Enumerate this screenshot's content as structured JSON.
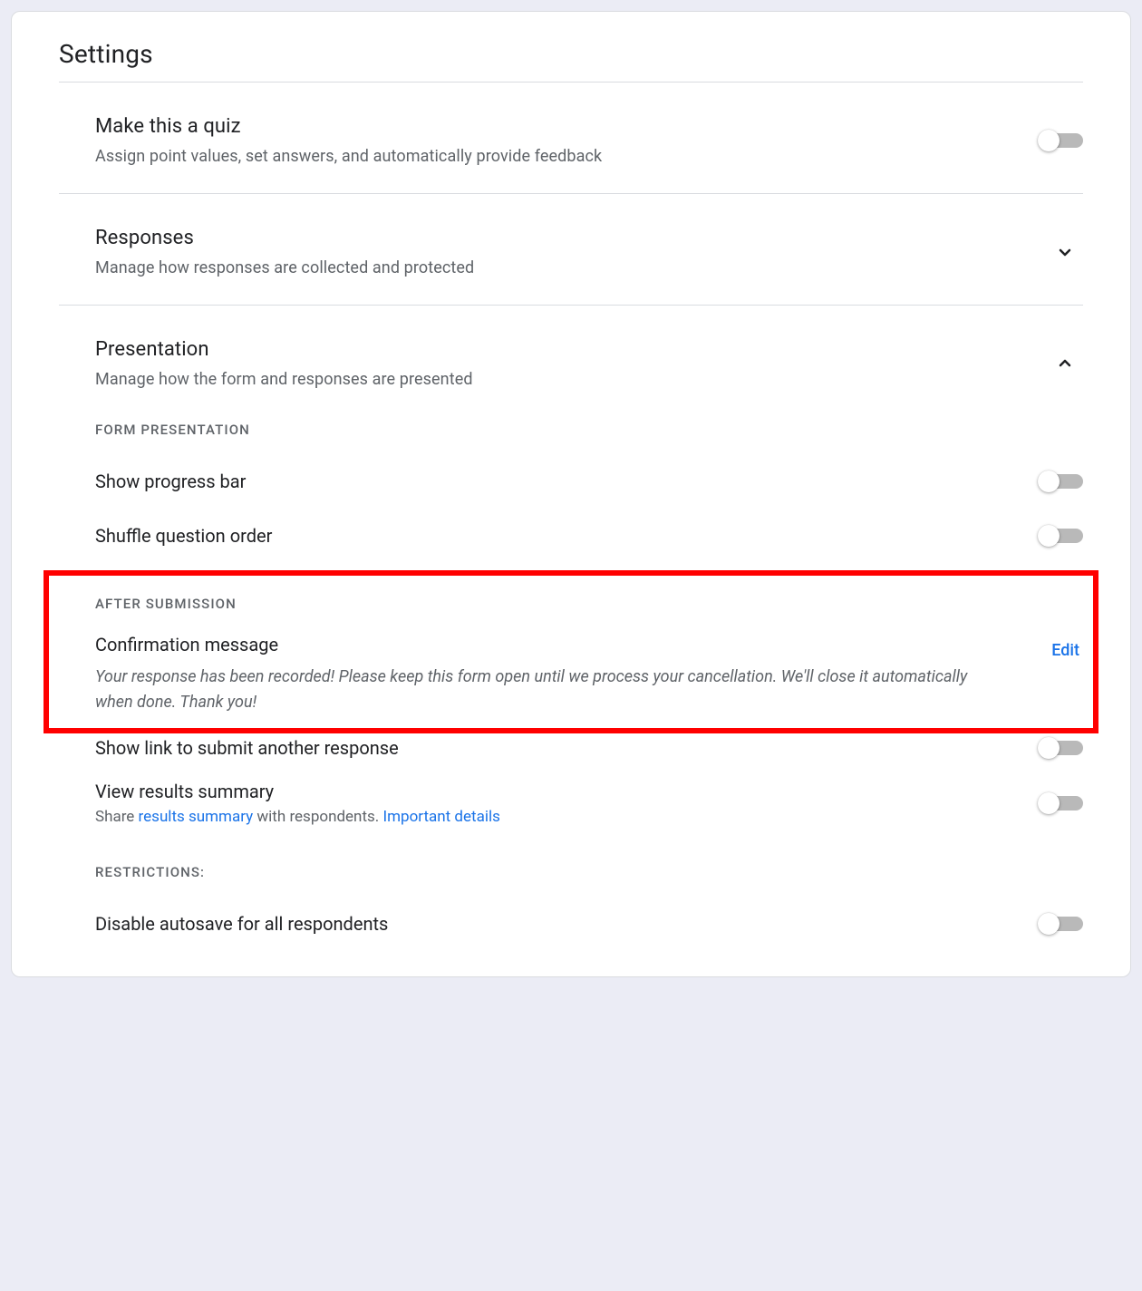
{
  "page_title": "Settings",
  "quiz": {
    "title": "Make this a quiz",
    "subtitle": "Assign point values, set answers, and automatically provide feedback",
    "enabled": false
  },
  "responses": {
    "title": "Responses",
    "subtitle": "Manage how responses are collected and protected",
    "expanded": false
  },
  "presentation": {
    "title": "Presentation",
    "subtitle": "Manage how the form and responses are presented",
    "expanded": true,
    "form_presentation_label": "FORM PRESENTATION",
    "show_progress_bar": {
      "label": "Show progress bar",
      "enabled": false
    },
    "shuffle_questions": {
      "label": "Shuffle question order",
      "enabled": false
    },
    "after_submission_label": "AFTER SUBMISSION",
    "confirmation": {
      "title": "Confirmation message",
      "message": "Your response has been recorded! Please keep this form open until we process your cancellation. We'll close it automatically when done. Thank you!",
      "edit_label": "Edit"
    },
    "show_submit_another": {
      "label": "Show link to submit another response",
      "enabled": false
    },
    "view_results": {
      "label": "View results summary",
      "sub_prefix": "Share ",
      "sub_link1": "results summary",
      "sub_mid": " with respondents. ",
      "sub_link2": "Important details",
      "enabled": false
    },
    "restrictions_label": "RESTRICTIONS:",
    "disable_autosave": {
      "label": "Disable autosave for all respondents",
      "enabled": false
    }
  }
}
